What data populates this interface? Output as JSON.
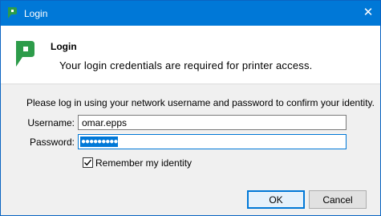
{
  "window": {
    "title": "Login",
    "close_glyph": "✕",
    "app_icon": "papercut-icon"
  },
  "header": {
    "title": "Login",
    "subtitle": "Your login credentials are required for printer access.",
    "logo_icon": "papercut-logo",
    "brand_color": "#2d9c4a"
  },
  "form": {
    "intro": "Please log in using your network username and password to confirm your identity.",
    "username_label": "Username:",
    "username_value": "omar.epps",
    "password_label": "Password:",
    "password_mask": "●●●●●●●●●",
    "remember_label": "Remember my identity",
    "remember_checked": true
  },
  "buttons": {
    "ok_label": "OK",
    "cancel_label": "Cancel"
  },
  "colors": {
    "titlebar": "#0078d7",
    "focus": "#0078d7"
  }
}
